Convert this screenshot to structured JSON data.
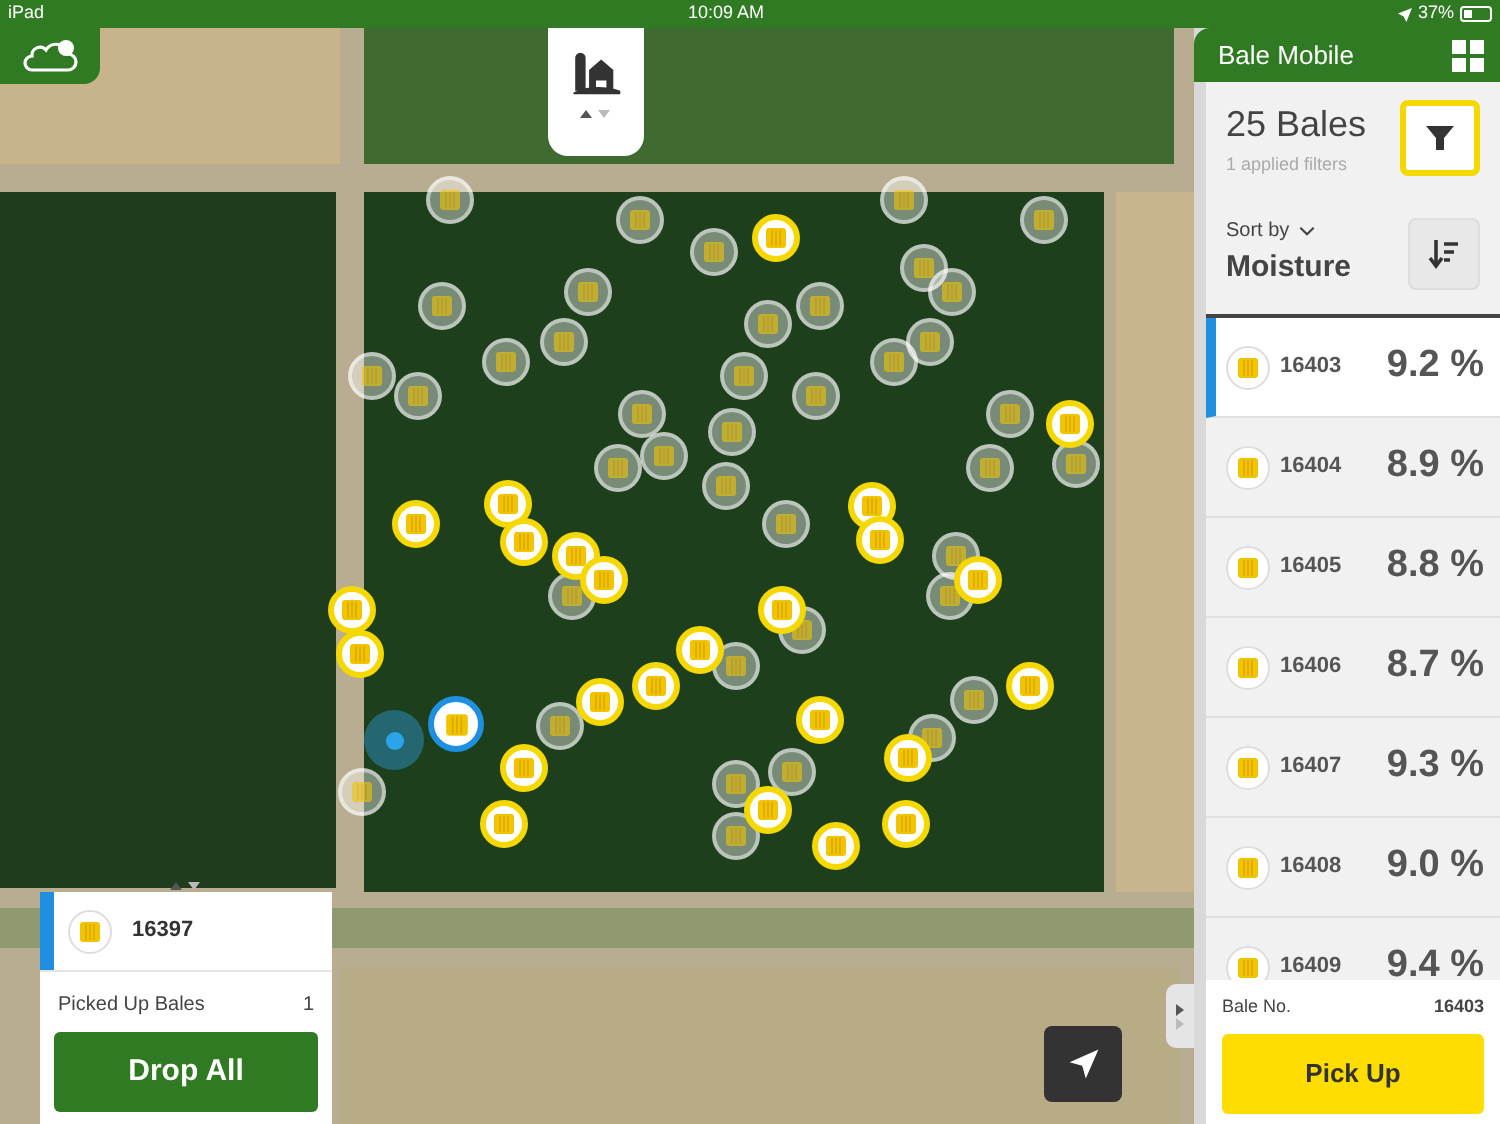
{
  "status_bar": {
    "device": "iPad",
    "time": "10:09 AM",
    "battery": "37%"
  },
  "panel": {
    "title": "Bale Mobile",
    "count": "25 Bales",
    "filters": "1 applied filters",
    "sort_label": "Sort by",
    "sort_value": "Moisture",
    "bales": [
      {
        "id": "16403",
        "moisture": "9.2 %",
        "selected": true
      },
      {
        "id": "16404",
        "moisture": "8.9 %",
        "selected": false
      },
      {
        "id": "16405",
        "moisture": "8.8 %",
        "selected": false
      },
      {
        "id": "16406",
        "moisture": "8.7 %",
        "selected": false
      },
      {
        "id": "16407",
        "moisture": "9.3 %",
        "selected": false
      },
      {
        "id": "16408",
        "moisture": "9.0 %",
        "selected": false
      },
      {
        "id": "16409",
        "moisture": "9.4 %",
        "selected": false
      }
    ],
    "detail_label": "Bale No.",
    "detail_value": "16403",
    "action": "Pick Up"
  },
  "picked_card": {
    "bale": "16397",
    "label": "Picked Up Bales",
    "count": "1",
    "action": "Drop All"
  }
}
